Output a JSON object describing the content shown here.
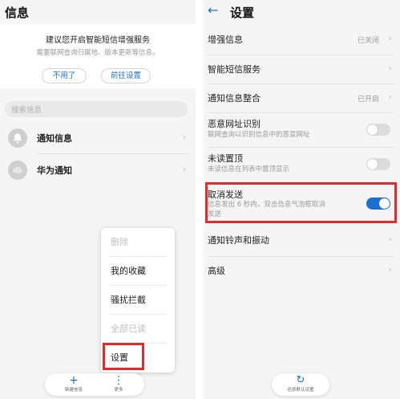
{
  "left": {
    "title": "信息",
    "promo": {
      "title": "建议您开启智能短信增强服务",
      "desc": "需要联网查询归属地、版本更新等信息。",
      "btn_no": "不用了",
      "btn_go": "前往设置"
    },
    "search_placeholder": "搜索信息",
    "conversations": [
      {
        "name": "通知信息",
        "icon": "bell-icon"
      },
      {
        "name": "华为通知",
        "icon": "huawei-logo-icon"
      }
    ],
    "menu": {
      "items": [
        {
          "label": "删除",
          "enabled": false
        },
        {
          "label": "我的收藏",
          "enabled": true
        },
        {
          "label": "骚扰拦截",
          "enabled": true
        },
        {
          "label": "全部已读",
          "enabled": false
        },
        {
          "label": "设置",
          "enabled": true
        }
      ]
    },
    "bottombar": {
      "new_label": "新建信息",
      "more_label": "更多"
    }
  },
  "right": {
    "title": "设置",
    "rows": [
      {
        "title": "增强信息",
        "value": "已关闭",
        "kind": "chevron"
      },
      {
        "title": "智能短信服务",
        "kind": "chevron"
      },
      {
        "title": "通知信息整合",
        "value": "已开启",
        "kind": "chevron"
      },
      {
        "title": "恶意网址识别",
        "subtitle": "联网查询以识别信息中的恶意网址",
        "kind": "toggle",
        "on": false
      },
      {
        "title": "未读置顶",
        "subtitle": "未读信息在列表中置顶显示",
        "kind": "toggle",
        "on": false
      },
      {
        "title": "取消发送",
        "subtitle_line1": "信息发出 6 秒内，双击信息气泡框取消",
        "subtitle_line2": "发送",
        "kind": "toggle",
        "on": true
      },
      {
        "title": "通知铃声和振动",
        "kind": "chevron"
      },
      {
        "title": "高级",
        "kind": "chevron"
      }
    ],
    "restore_label": "还原默认设置"
  },
  "colors": {
    "accent": "#1a6fd6",
    "highlight": "#e22b2b",
    "background": "#f5f5f5"
  }
}
